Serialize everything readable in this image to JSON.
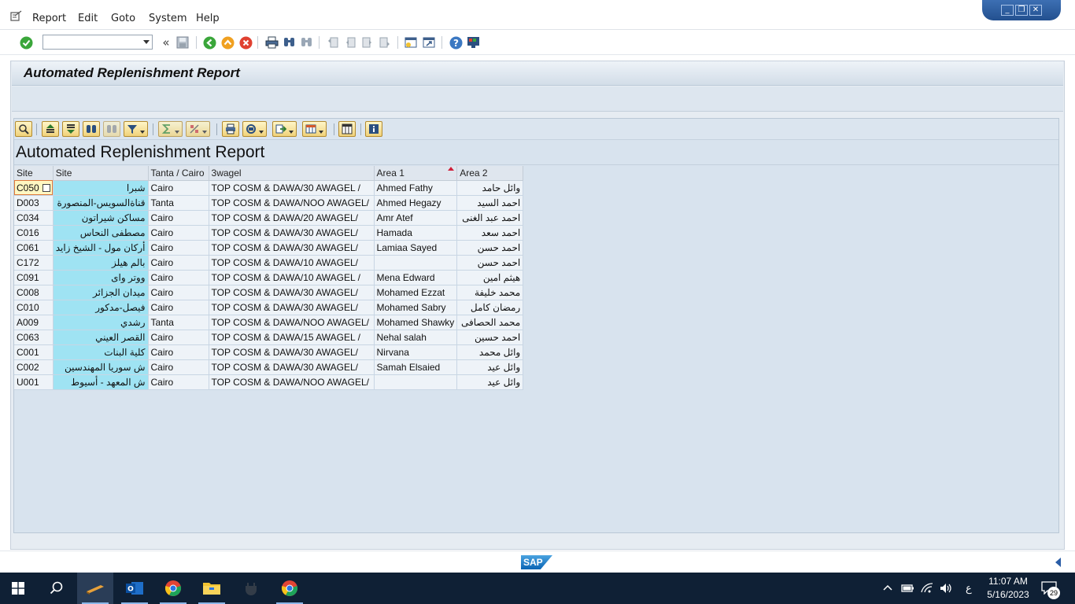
{
  "menu": {
    "items": [
      {
        "label": "Report"
      },
      {
        "label": "Edit"
      },
      {
        "label": "Goto"
      },
      {
        "label": "System"
      },
      {
        "label": "Help"
      }
    ]
  },
  "window_controls": {
    "minimize": "_",
    "restore": "❐",
    "close": "✕"
  },
  "toolbar": {
    "command_field_value": "",
    "icons": [
      "enter-icon",
      "back-double-icon",
      "save-icon",
      "back-icon",
      "exit-icon",
      "cancel-icon",
      "print-icon",
      "find-icon",
      "find-next-icon",
      "first-page-icon",
      "prev-page-icon",
      "next-page-icon",
      "last-page-icon",
      "create-session-icon",
      "shortcut-icon",
      "help-icon",
      "customize-layout-icon"
    ]
  },
  "page": {
    "title": "Automated Replenishment Report"
  },
  "alv": {
    "title": "Automated Replenishment Report",
    "columns": [
      "Site",
      "Site",
      "Tanta / Cairo",
      "3wagel",
      "Area 1",
      "Area 2"
    ],
    "rows": [
      [
        "C050",
        "شبرا",
        "Cairo",
        "TOP COSM & DAWA/30 AWAGEL /",
        "Ahmed Fathy",
        "وائل حامد"
      ],
      [
        "D003",
        "قناةالسويس-المنصورة",
        "Tanta",
        "TOP COSM & DAWA/NOO AWAGEL/",
        "Ahmed Hegazy",
        "احمد السيد"
      ],
      [
        "C034",
        "مساكن شيراتون",
        "Cairo",
        "TOP COSM & DAWA/20 AWAGEL/",
        "Amr Atef",
        "احمد عبد الغنى"
      ],
      [
        "C016",
        "مصطفى النحاس",
        "Cairo",
        "TOP COSM & DAWA/30 AWAGEL/",
        "Hamada",
        "احمد سعد"
      ],
      [
        "C061",
        "أركان مول - الشيخ زايد",
        "Cairo",
        "TOP COSM & DAWA/30 AWAGEL/",
        "Lamiaa Sayed",
        "احمد حسن"
      ],
      [
        "C172",
        "بالم هيلز",
        "Cairo",
        "TOP COSM & DAWA/10 AWAGEL/",
        "",
        "احمد حسن"
      ],
      [
        "C091",
        "ووتر واى",
        "Cairo",
        "TOP COSM & DAWA/10 AWAGEL /",
        "Mena Edward",
        "هيثم امين"
      ],
      [
        "C008",
        "ميدان الجزائر",
        "Cairo",
        "TOP COSM & DAWA/30 AWAGEL/",
        "Mohamed Ezzat",
        "محمد خليفة"
      ],
      [
        "C010",
        "فيصل-مدكور",
        "Cairo",
        "TOP COSM & DAWA/30 AWAGEL/",
        "Mohamed Sabry",
        "رمضان كامل"
      ],
      [
        "A009",
        "رشدي",
        "Tanta",
        "TOP COSM & DAWA/NOO AWAGEL/",
        "Mohamed Shawky",
        "محمد الحصافى"
      ],
      [
        "C063",
        "القصر العيني",
        "Cairo",
        "TOP COSM & DAWA/15 AWAGEL /",
        "Nehal salah",
        "احمد حسين"
      ],
      [
        "C001",
        "كلية البنات",
        "Cairo",
        "TOP COSM & DAWA/30 AWAGEL/",
        "Nirvana",
        "وائل محمد"
      ],
      [
        "C002",
        "ش سوريا المهندسين",
        "Cairo",
        "TOP COSM & DAWA/30 AWAGEL/",
        "Samah Elsaied",
        "وائل عيد"
      ],
      [
        "U001",
        "ش المعهد - أسيوط",
        "Cairo",
        "TOP COSM & DAWA/NOO AWAGEL/",
        "",
        "وائل عيد"
      ]
    ]
  },
  "status_bar": {
    "logo_text": "SAP"
  },
  "taskbar": {
    "time": "11:07 AM",
    "date": "5/16/2023",
    "lang": "ع",
    "notifications": "29"
  },
  "colors": {
    "accent": "#2a5da6",
    "site_col": "#9fe3f3",
    "frame": "#e6ecf2"
  }
}
